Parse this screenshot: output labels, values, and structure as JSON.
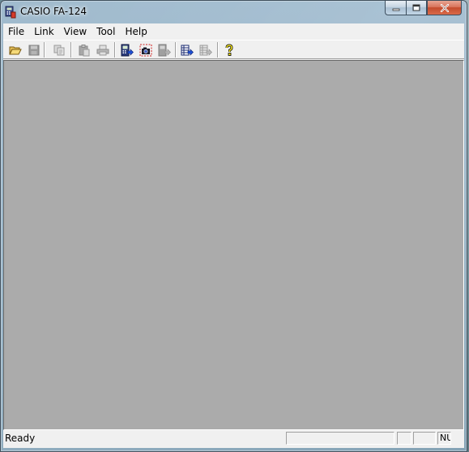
{
  "window": {
    "title": "CASIO FA-124"
  },
  "menu": {
    "items": [
      {
        "label": "File"
      },
      {
        "label": "Link"
      },
      {
        "label": "View"
      },
      {
        "label": "Tool"
      },
      {
        "label": "Help"
      }
    ]
  },
  "toolbar": {
    "buttons": [
      {
        "icon": "open-folder-icon",
        "enabled": true
      },
      {
        "icon": "save-icon",
        "enabled": false
      },
      {
        "icon": "copy-icon",
        "enabled": false
      },
      {
        "icon": "paste-icon",
        "enabled": false
      },
      {
        "icon": "print-icon",
        "enabled": false
      },
      {
        "icon": "send-to-calculator-icon",
        "enabled": true
      },
      {
        "icon": "capture-screen-icon",
        "enabled": true
      },
      {
        "icon": "receive-from-calculator-icon",
        "enabled": false
      },
      {
        "icon": "transfer-list-icon",
        "enabled": true
      },
      {
        "icon": "transfer-list-disabled-icon",
        "enabled": false
      },
      {
        "icon": "help-icon",
        "enabled": true
      }
    ]
  },
  "status": {
    "text": "Ready",
    "num_indicator": "NUM"
  },
  "colors": {
    "workspace": "#ababab",
    "chrome": "#f0f0f0",
    "close_button": "#c44c2d"
  }
}
